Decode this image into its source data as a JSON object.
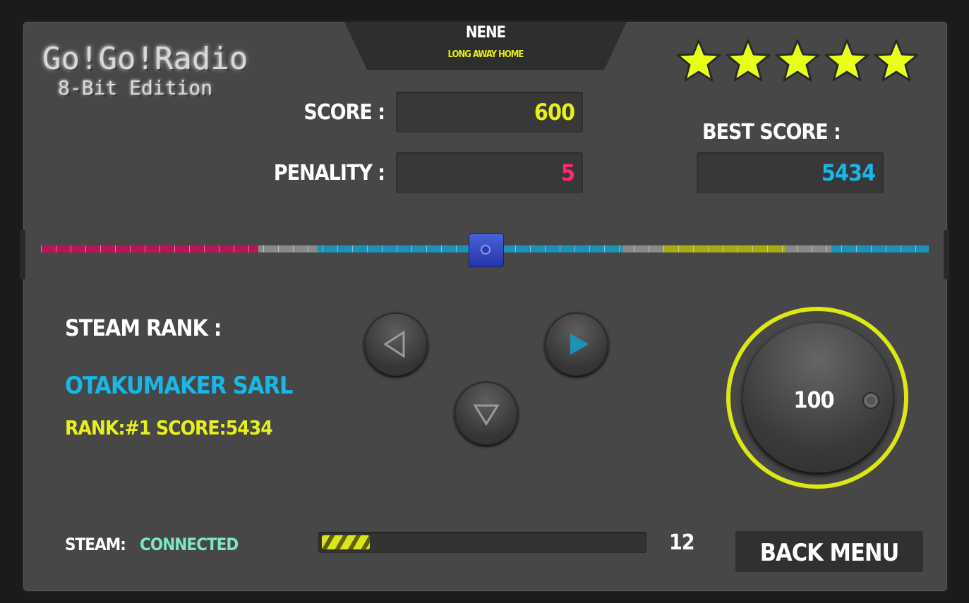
{
  "logo": {
    "line1": "Go!Go!Radio",
    "line2": "8-Bit Edition"
  },
  "song": {
    "artist": "NENE",
    "title": "LONG AWAY HOME"
  },
  "rating": {
    "stars": 5,
    "max": 5,
    "color": "#e8ff1a"
  },
  "score": {
    "label": "SCORE :",
    "value": "600",
    "color": "#e8f01a"
  },
  "penalty": {
    "label": "PENALITY :",
    "value": "5",
    "color": "#ff2a6e"
  },
  "best": {
    "label": "BEST SCORE :",
    "value": "5434",
    "color": "#18b7e6"
  },
  "timeline": {
    "position": 0.5,
    "segments": [
      {
        "from": 0.0,
        "to": 0.245,
        "color": "#b8145a"
      },
      {
        "from": 0.245,
        "to": 0.312,
        "color": "#8a8a8a"
      },
      {
        "from": 0.312,
        "to": 0.655,
        "color": "#1b92b5"
      },
      {
        "from": 0.655,
        "to": 0.7,
        "color": "#8a8a8a"
      },
      {
        "from": 0.7,
        "to": 0.838,
        "color": "#a6ab14"
      },
      {
        "from": 0.838,
        "to": 0.89,
        "color": "#8a8a8a"
      },
      {
        "from": 0.89,
        "to": 1.0,
        "color": "#1b92b5"
      }
    ]
  },
  "steam_rank": {
    "heading": "STEAM RANK :",
    "user": "OTAKUMAKER SARL",
    "user_color": "#18b7e6",
    "rank_line": "RANK:#1 SCORE:5434",
    "rank_color": "#e8f01a"
  },
  "controls": {
    "left": "left-arrow-icon",
    "right": "right-arrow-icon",
    "down": "down-arrow-icon",
    "right_color": "#1b92b5"
  },
  "dial": {
    "value": "100",
    "ring_color": "#dce713"
  },
  "status": {
    "label": "STEAM:",
    "value": "CONNECTED",
    "value_color": "#7ee6c6"
  },
  "progress": {
    "fraction": 0.15,
    "count": "12"
  },
  "back_button": {
    "label": "BACK MENU"
  }
}
